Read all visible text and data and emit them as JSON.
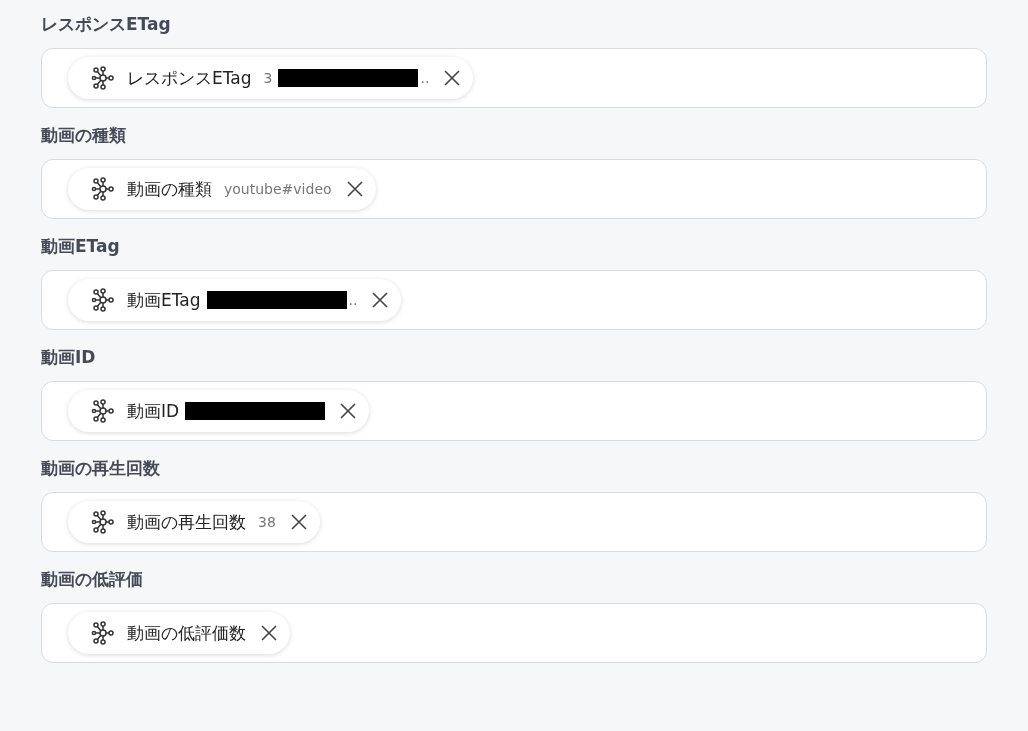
{
  "fields": [
    {
      "label": "レスポンスETag",
      "chip": {
        "label": "レスポンスETag",
        "value": "3",
        "redacted": true,
        "suffix": ".."
      }
    },
    {
      "label": "動画の種類",
      "chip": {
        "label": "動画の種類",
        "value": "youtube#video"
      }
    },
    {
      "label": "動画ETag",
      "chip": {
        "label": "動画ETag",
        "redacted": true,
        "suffix": ".."
      }
    },
    {
      "label": "動画ID",
      "chip": {
        "label": "動画ID",
        "redacted": true
      }
    },
    {
      "label": "動画の再生回数",
      "chip": {
        "label": "動画の再生回数",
        "value": "38"
      }
    },
    {
      "label": "動画の低評価",
      "chip": {
        "label": "動画の低評価数"
      }
    }
  ]
}
